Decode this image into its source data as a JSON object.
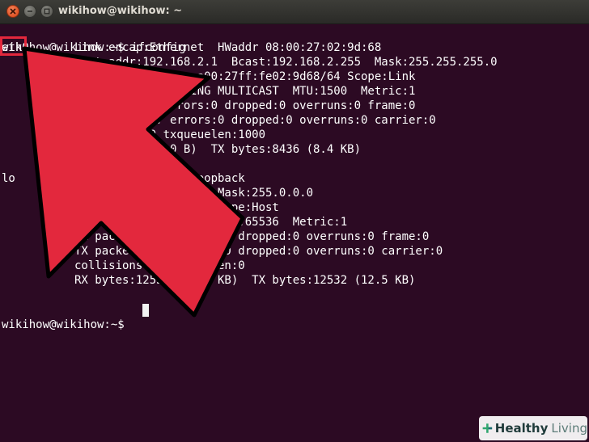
{
  "window": {
    "title": "wikihow@wikihow: ~"
  },
  "colors": {
    "terminal_bg": "#2c0a23",
    "terminal_text": "#ffffff",
    "highlight": "#e3283d"
  },
  "terminal": {
    "command_line": "wikihow@wikihow:~$ ifconfig",
    "lines": [
      {
        "iface": "eth0",
        "text": "Link encap:Ethernet  HWaddr 08:00:27:02:9d:68"
      },
      {
        "iface": "",
        "text": "inet addr:192.168.2.1  Bcast:192.168.2.255  Mask:255.255.255.0"
      },
      {
        "iface": "",
        "text": "inet6 addr: fe80::a00:27ff:fe02:9d68/64 Scope:Link"
      },
      {
        "iface": "",
        "text": "UP BROADCAST RUNNING MULTICAST  MTU:1500  Metric:1"
      },
      {
        "iface": "",
        "text": "RX packets:0 errors:0 dropped:0 overruns:0 frame:0"
      },
      {
        "iface": "",
        "text": "TX packets:87 errors:0 dropped:0 overruns:0 carrier:0"
      },
      {
        "iface": "",
        "text": "collisions:0 txqueuelen:1000"
      },
      {
        "iface": "",
        "text": "RX bytes:0 (0.0 B)  TX bytes:8436 (8.4 KB)"
      },
      {
        "iface": "",
        "text": ""
      },
      {
        "iface": "lo",
        "text": "Link encap:Local Loopback"
      },
      {
        "iface": "",
        "text": "inet addr:127.0.0.1  Mask:255.0.0.0"
      },
      {
        "iface": "",
        "text": "inet6 addr: ::1/128 Scope:Host"
      },
      {
        "iface": "",
        "text": "UP LOOPBACK RUNNING  MTU:65536  Metric:1"
      },
      {
        "iface": "",
        "text": "RX packets:171 errors:0 dropped:0 overruns:0 frame:0"
      },
      {
        "iface": "",
        "text": "TX packets:171 errors:0 dropped:0 overruns:0 carrier:0"
      },
      {
        "iface": "",
        "text": "collisions:0 txqueuelen:0"
      },
      {
        "iface": "",
        "text": "RX bytes:12532 (12.5 KB)  TX bytes:12532 (12.5 KB)"
      }
    ],
    "final_prompt": "wikihow@wikihow:~$ "
  },
  "watermark": {
    "brand_bold": "Healthy",
    "brand_light": "Living",
    "icon": "plus-leaf-icon"
  }
}
